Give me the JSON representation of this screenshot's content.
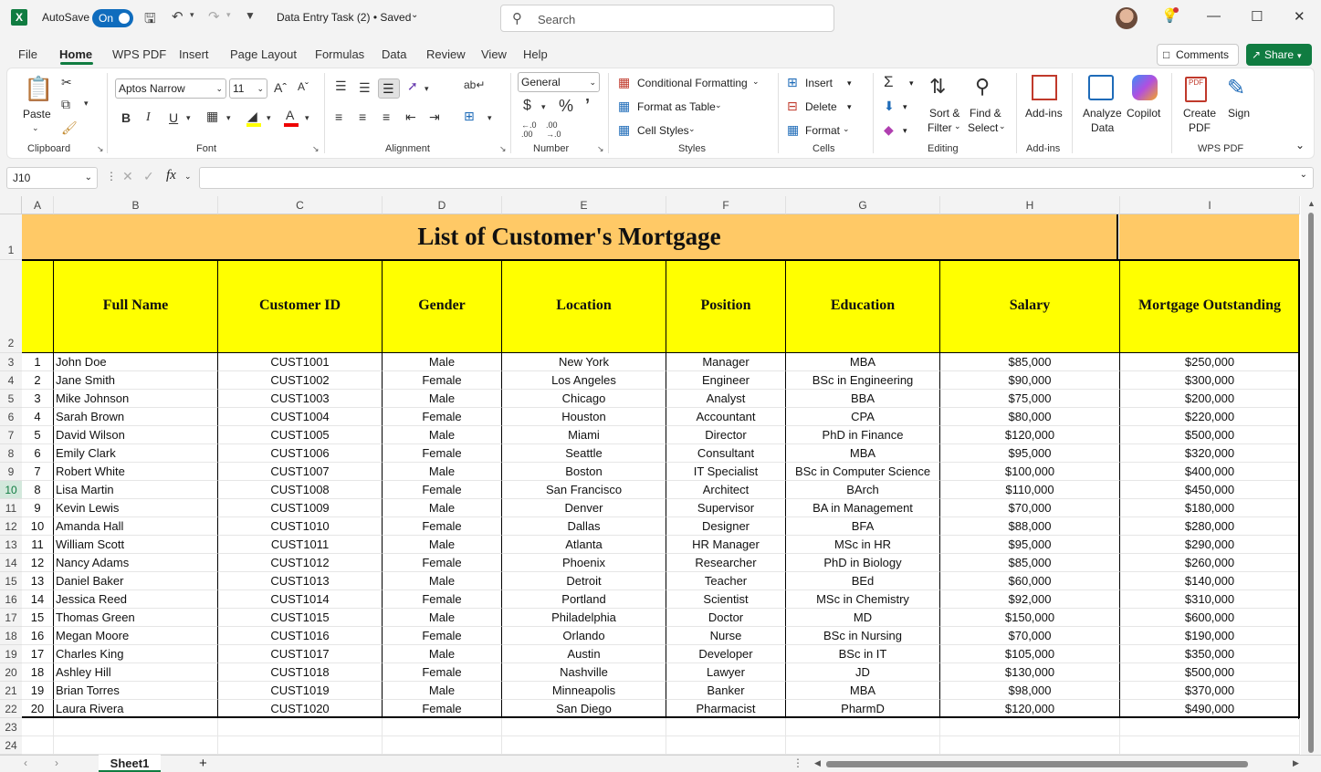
{
  "titlebar": {
    "autosave_label": "AutoSave",
    "autosave_state": "On",
    "doc_title": "Data Entry Task (2) • Saved",
    "search_placeholder": "Search"
  },
  "tabs": [
    "File",
    "Home",
    "WPS PDF",
    "Insert",
    "Page Layout",
    "Formulas",
    "Data",
    "Review",
    "View",
    "Help"
  ],
  "active_tab": "Home",
  "actions": {
    "comments": "Comments",
    "share": "Share"
  },
  "ribbon": {
    "clipboard": {
      "paste": "Paste",
      "label": "Clipboard"
    },
    "font": {
      "name": "Aptos Narrow",
      "size": "11",
      "label": "Font"
    },
    "alignment": {
      "label": "Alignment"
    },
    "number": {
      "format": "General",
      "label": "Number"
    },
    "styles": {
      "conditional": "Conditional Formatting",
      "format_table": "Format as Table",
      "cell_styles": "Cell Styles",
      "label": "Styles"
    },
    "cells": {
      "insert": "Insert",
      "delete": "Delete",
      "format": "Format",
      "label": "Cells"
    },
    "editing": {
      "sort1": "Sort &",
      "sort2": "Filter",
      "find1": "Find &",
      "find2": "Select",
      "label": "Editing"
    },
    "addins": {
      "btn": "Add-ins",
      "label": "Add-ins"
    },
    "analyze": {
      "l1": "Analyze",
      "l2": "Data"
    },
    "copilot": "Copilot",
    "wps": {
      "create1": "Create",
      "create2": "PDF",
      "sign": "Sign",
      "label": "WPS PDF"
    }
  },
  "formula_bar": {
    "namebox": "J10",
    "fx": "fx",
    "value": ""
  },
  "sheet": {
    "columns": [
      "A",
      "B",
      "C",
      "D",
      "E",
      "F",
      "G",
      "H",
      "I"
    ],
    "title": "List of Customer's Mortgage",
    "headers": [
      "Full Name",
      "Customer ID",
      "Gender",
      "Location",
      "Position",
      "Education",
      "Salary",
      "Mortgage Outstanding"
    ],
    "rows": [
      [
        "1",
        "John Doe",
        "CUST1001",
        "Male",
        "New York",
        "Manager",
        "MBA",
        "$85,000",
        "$250,000"
      ],
      [
        "2",
        "Jane Smith",
        "CUST1002",
        "Female",
        "Los Angeles",
        "Engineer",
        "BSc in Engineering",
        "$90,000",
        "$300,000"
      ],
      [
        "3",
        "Mike Johnson",
        "CUST1003",
        "Male",
        "Chicago",
        "Analyst",
        "BBA",
        "$75,000",
        "$200,000"
      ],
      [
        "4",
        "Sarah Brown",
        "CUST1004",
        "Female",
        "Houston",
        "Accountant",
        "CPA",
        "$80,000",
        "$220,000"
      ],
      [
        "5",
        "David Wilson",
        "CUST1005",
        "Male",
        "Miami",
        "Director",
        "PhD in Finance",
        "$120,000",
        "$500,000"
      ],
      [
        "6",
        "Emily Clark",
        "CUST1006",
        "Female",
        "Seattle",
        "Consultant",
        "MBA",
        "$95,000",
        "$320,000"
      ],
      [
        "7",
        "Robert White",
        "CUST1007",
        "Male",
        "Boston",
        "IT Specialist",
        "BSc in Computer Science",
        "$100,000",
        "$400,000"
      ],
      [
        "8",
        "Lisa Martin",
        "CUST1008",
        "Female",
        "San Francisco",
        "Architect",
        "BArch",
        "$110,000",
        "$450,000"
      ],
      [
        "9",
        "Kevin Lewis",
        "CUST1009",
        "Male",
        "Denver",
        "Supervisor",
        "BA in Management",
        "$70,000",
        "$180,000"
      ],
      [
        "10",
        "Amanda Hall",
        "CUST1010",
        "Female",
        "Dallas",
        "Designer",
        "BFA",
        "$88,000",
        "$280,000"
      ],
      [
        "11",
        "William Scott",
        "CUST1011",
        "Male",
        "Atlanta",
        "HR Manager",
        "MSc in HR",
        "$95,000",
        "$290,000"
      ],
      [
        "12",
        "Nancy Adams",
        "CUST1012",
        "Female",
        "Phoenix",
        "Researcher",
        "PhD in Biology",
        "$85,000",
        "$260,000"
      ],
      [
        "13",
        "Daniel Baker",
        "CUST1013",
        "Male",
        "Detroit",
        "Teacher",
        "BEd",
        "$60,000",
        "$140,000"
      ],
      [
        "14",
        "Jessica Reed",
        "CUST1014",
        "Female",
        "Portland",
        "Scientist",
        "MSc in Chemistry",
        "$92,000",
        "$310,000"
      ],
      [
        "15",
        "Thomas Green",
        "CUST1015",
        "Male",
        "Philadelphia",
        "Doctor",
        "MD",
        "$150,000",
        "$600,000"
      ],
      [
        "16",
        "Megan Moore",
        "CUST1016",
        "Female",
        "Orlando",
        "Nurse",
        "BSc in Nursing",
        "$70,000",
        "$190,000"
      ],
      [
        "17",
        "Charles King",
        "CUST1017",
        "Male",
        "Austin",
        "Developer",
        "BSc in IT",
        "$105,000",
        "$350,000"
      ],
      [
        "18",
        "Ashley Hill",
        "CUST1018",
        "Female",
        "Nashville",
        "Lawyer",
        "JD",
        "$130,000",
        "$500,000"
      ],
      [
        "19",
        "Brian Torres",
        "CUST1019",
        "Male",
        "Minneapolis",
        "Banker",
        "MBA",
        "$98,000",
        "$370,000"
      ],
      [
        "20",
        "Laura Rivera",
        "CUST1020",
        "Female",
        "San Diego",
        "Pharmacist",
        "PharmD",
        "$120,000",
        "$490,000"
      ]
    ],
    "row_numbers": [
      "1",
      "2",
      "3",
      "4",
      "5",
      "6",
      "7",
      "8",
      "9",
      "10",
      "11",
      "12",
      "13",
      "14",
      "15",
      "16",
      "17",
      "18",
      "19",
      "20",
      "21",
      "22",
      "23",
      "24"
    ],
    "tab_name": "Sheet1"
  },
  "colors": {
    "title_fill": "#ffc966",
    "header_fill": "#ffff00",
    "excel_green": "#107c41"
  }
}
